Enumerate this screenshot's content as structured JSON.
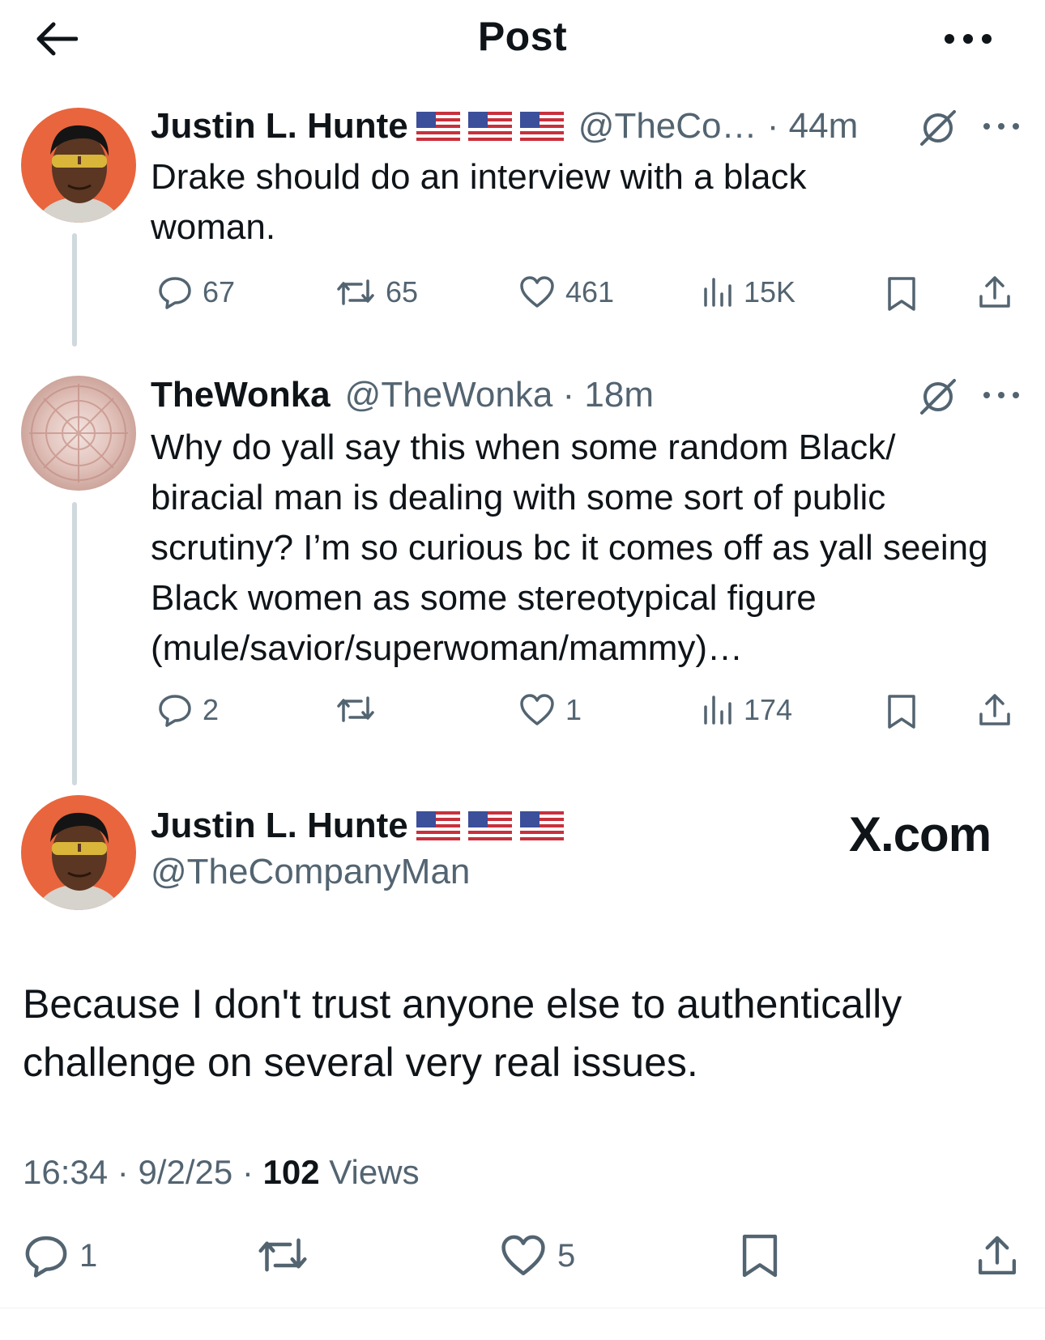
{
  "header": {
    "title": "Post"
  },
  "thread": [
    {
      "name": "Justin L. Hunte",
      "flags": [
        "🇺🇸",
        "🇺🇸",
        "🇺🇸"
      ],
      "handle": "@TheCo…",
      "time": "44m",
      "text": "Drake should do an interview with a black woman.",
      "replies": "67",
      "reposts": "65",
      "likes": "461",
      "views": "15K"
    },
    {
      "name": "TheWonka",
      "handle": "@TheWonka",
      "time": "18m",
      "text": "Why do yall say this when some random Black/ biracial man is dealing with some sort of public scrutiny? I’m so curious bc it comes off as yall seeing Black women as some stereotypical figure (mule/savior/superwoman/mammy)…",
      "replies": "2",
      "reposts": "",
      "likes": "1",
      "views": "174"
    }
  ],
  "main": {
    "name": "Justin L. Hunte",
    "flags": [
      "🇺🇸",
      "🇺🇸",
      "🇺🇸"
    ],
    "handle": "@TheCompanyMan",
    "watermark": "X.com",
    "text": "Because I don't trust anyone else to authentically challenge on several very real issues.",
    "time": "16:34",
    "date": "9/2/25",
    "views_count": "102",
    "views_label": "Views",
    "replies": "1",
    "reposts": "",
    "likes": "5"
  },
  "colors": {
    "text": "#0f1419",
    "muted": "#536471",
    "thread_line": "#cfd9de"
  },
  "icons": [
    "back-arrow-icon",
    "more-icon",
    "grok-icon",
    "reply-icon",
    "repost-icon",
    "like-icon",
    "views-icon",
    "bookmark-icon",
    "share-icon",
    "flag-us-icon"
  ]
}
